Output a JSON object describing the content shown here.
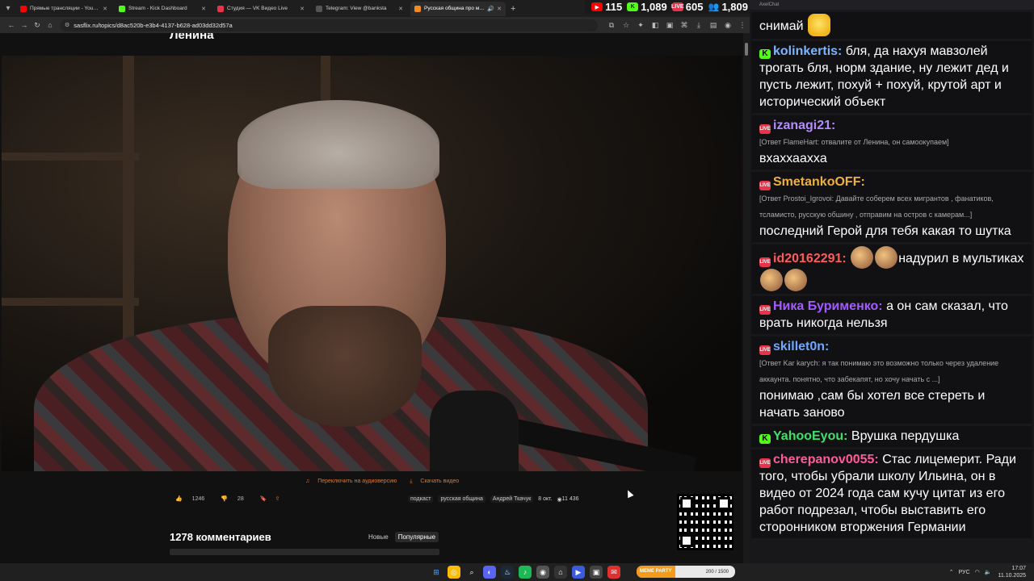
{
  "browser": {
    "tabs": [
      {
        "label": "Прямые трансляции - YouTube",
        "color": "#ff0000",
        "active": false
      },
      {
        "label": "Stream - Kick Dashboard",
        "color": "#53fc18",
        "active": false
      },
      {
        "label": "Студия — VK Видео Live",
        "color": "#e8334b",
        "active": false
      },
      {
        "label": "Telegram: View @banksta",
        "color": "#3b3b3b",
        "active": false
      },
      {
        "label": "Русская община про миг...",
        "color": "#f28b1d",
        "active": true
      }
    ],
    "url": "sasflix.ru/topics/d8ac520b-e3b4-4137-b628-ad03dd32d57a"
  },
  "stats": [
    {
      "icon": "youtube-icon",
      "value": "115",
      "color": "#ff0000"
    },
    {
      "icon": "kick-icon",
      "value": "1,089",
      "color": "#53fc18"
    },
    {
      "icon": "vk-live-icon",
      "value": "605",
      "color": "#e8334b"
    },
    {
      "icon": "viewers-icon",
      "value": "1,809",
      "color": "#3c8dff"
    }
  ],
  "page": {
    "title_partial": "Ленина",
    "audio_link": "Переключить на аудиоверсию",
    "download_link": "Скачать видео",
    "likes": "1246",
    "dislikes": "28",
    "tags": [
      "подкаст",
      "русская община"
    ],
    "author": "Андрей Ткачук",
    "date": "8 окт.",
    "views": "11 436",
    "comments_title": "1278 комментариев",
    "sort_new": "Новые",
    "sort_popular": "Популярные"
  },
  "chat": {
    "window_title": "AxelChat",
    "messages": [
      {
        "platform": "",
        "user": "",
        "user_color": "#fff",
        "reply": "",
        "text": "снимай"
      },
      {
        "platform": "kick",
        "user": "kolinkertis:",
        "user_color": "#7db5ff",
        "reply": "",
        "text": "бля, да нахуя мавзолей трогать бля, норм здание, ну лежит дед и пусть лежит, похуй + похуй, крутой арт и исторический объект"
      },
      {
        "platform": "vk",
        "user": "izanagi21:",
        "user_color": "#b58cff",
        "reply": "[Ответ FlameHart: отвалите от Ленина, он самоокупаем]",
        "text": "вхаххааххa"
      },
      {
        "platform": "vk",
        "user": "SmetankoOFF:",
        "user_color": "#f0b13b",
        "reply": "[Ответ Prostoi_Igrovoi: Давайте соберем всех мигрантов , фанатиков, тсламисто, русскую обшину , отправим на остров с камерам...]",
        "text": "последний Герой для тебя какая то шутка"
      },
      {
        "platform": "vk",
        "user": "id20162291:",
        "user_color": "#ff5b5b",
        "reply": "",
        "text": "надурил в мультиках"
      },
      {
        "platform": "vk",
        "user": "Ника Бурименко:",
        "user_color": "#a35cff",
        "reply": "",
        "text": "а он сам сказал, что врать никогда нельзя"
      },
      {
        "platform": "vk",
        "user": "skillet0n:",
        "user_color": "#6fa8ff",
        "reply": "[Ответ Kar karych: я так понимаю это возможно только через удаление аккаунта. понятно, что забекапят, но хочу начать с ...]",
        "text": "понимаю ,сам бы хотел все стереть и начать заново"
      },
      {
        "platform": "kick",
        "user": "YahooEyou:",
        "user_color": "#3ee06a",
        "reply": "",
        "text": "Врушка пердушка"
      },
      {
        "platform": "vk",
        "user": "cherepanov0055:",
        "user_color": "#ff5b9a",
        "reply": "",
        "text": "Стас лицемерит. Ради того, чтобы убрали школу Ильина, он в видео от 2024 года сам кучу цитат из его работ подрезал, чтобы выставить его сторонником вторжения Германии"
      }
    ]
  },
  "taskbar": {
    "meme_label": "MEME PARTY",
    "meme_value": "200 / 1500",
    "lang": "РУС",
    "time": "17:07",
    "date": "11.10.2025"
  }
}
